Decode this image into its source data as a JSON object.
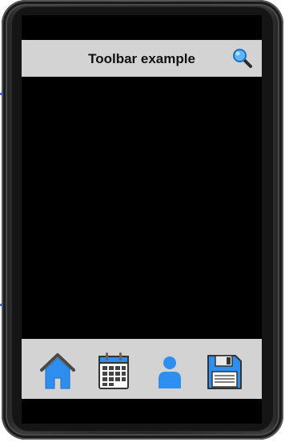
{
  "toolbar": {
    "title": "Toolbar example",
    "search_icon": "search-icon"
  },
  "bottom_nav": {
    "items": [
      {
        "icon": "home-icon"
      },
      {
        "icon": "calendar-icon"
      },
      {
        "icon": "user-icon"
      },
      {
        "icon": "save-icon"
      }
    ]
  },
  "colors": {
    "toolbar_bg": "#d3d3d3",
    "screen_bg": "#000000",
    "icon_blue": "#2f8ff0",
    "frame": "#2b2b2b"
  }
}
